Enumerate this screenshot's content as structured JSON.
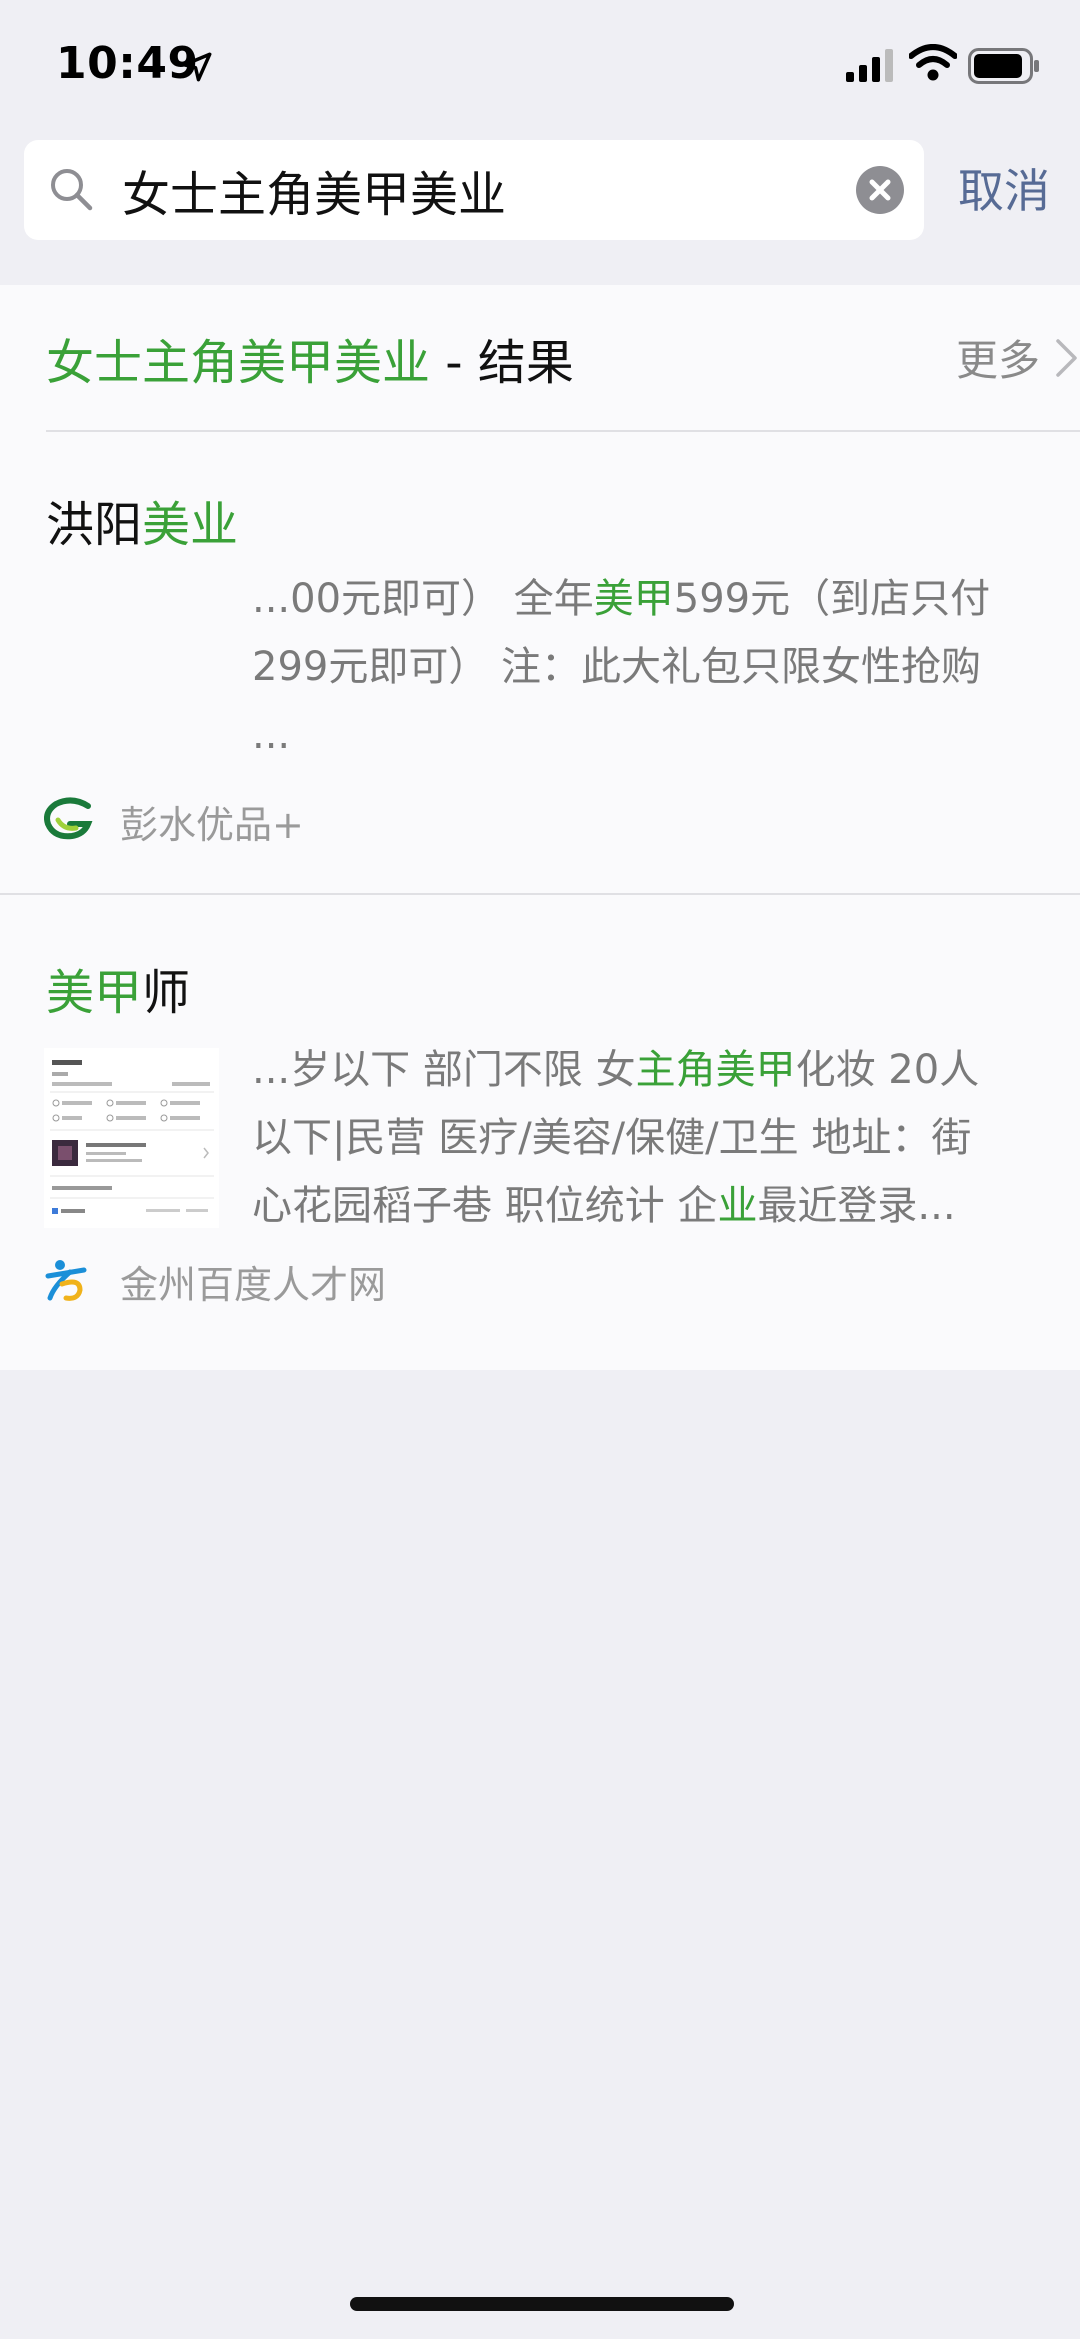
{
  "status_bar": {
    "time": "10:49"
  },
  "search": {
    "query": "女士主角美甲美业",
    "cancel_label": "取消"
  },
  "results_header": {
    "query_part": "女士主角美甲美业",
    "suffix": " - 结果",
    "more_label": "更多"
  },
  "results": [
    {
      "title_parts": [
        "洪阳",
        "美业"
      ],
      "snippet": "...00元即可） 全年美甲599元（到店只付299元即可） 注：此大礼包只限女性抢购...",
      "snippet_parts": [
        "...00元即可） 全年",
        "美甲",
        "599元（到店只付",
        "299元即可） 注：此大礼包只限女性抢购",
        "..."
      ],
      "source": "彭水优品+"
    },
    {
      "title_parts": [
        "美甲",
        "师"
      ],
      "snippet": "...岁以下 部门不限 女主角美甲化妆 20人以下|民营 医疗/美容/保健/卫生 地址：街心花园稻子巷 职位统计 企业最近登录...",
      "snippet_parts": [
        "...岁以下 部门不限 女",
        "主角美甲",
        "化妆 20人",
        "以下|民营 医疗/美容/保健/卫生 地址：街",
        "心花园稻子巷 职位统计 企",
        "业",
        "最近登录..."
      ],
      "source": "金州百度人才网"
    }
  ],
  "colors": {
    "highlight": "#3aa138",
    "link_blue": "#576b95",
    "background": "#efeff4"
  }
}
